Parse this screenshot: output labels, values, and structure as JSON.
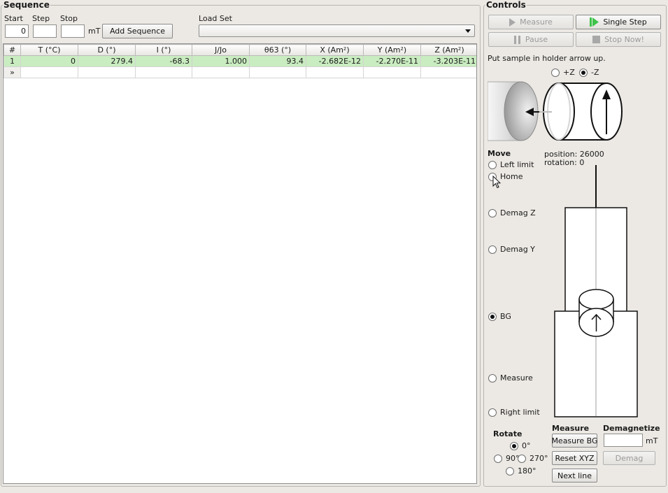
{
  "sequence": {
    "legend": "Sequence",
    "start_label": "Start",
    "step_label": "Step",
    "stop_label": "Stop",
    "start_value": "0",
    "step_value": "",
    "stop_value": "",
    "unit": "mT",
    "add_button": "Add Sequence",
    "load_set_label": "Load Set",
    "load_set_value": ""
  },
  "table": {
    "headers": [
      "#",
      "T (°C)",
      "D (°)",
      "I (°)",
      "J/Jo",
      "θ63 (°)",
      "X (Am²)",
      "Y (Am²)",
      "Z (Am²)"
    ],
    "rows": [
      [
        "1",
        "0",
        "279.4",
        "-68.3",
        "1.000",
        "93.4",
        "-2.682E-12",
        "-2.270E-11",
        "-3.203E-11"
      ]
    ],
    "new_row_marker": "»"
  },
  "controls": {
    "legend": "Controls",
    "measure_button": "Measure",
    "single_step_button": "Single Step",
    "pause_button": "Pause",
    "stop_now_button": "Stop Now!",
    "instruction": "Put sample in holder arrow up.",
    "orientation_options": [
      {
        "label": "+Z",
        "selected": false
      },
      {
        "label": "-Z",
        "selected": true
      }
    ],
    "move_label": "Move",
    "position_text": "position: 26000",
    "rotation_text": "rotation: 0",
    "move_options": [
      {
        "label": "Left limit",
        "selected": false
      },
      {
        "label": "Home",
        "selected": false
      },
      {
        "label": "Demag Z",
        "selected": false
      },
      {
        "label": "Demag Y",
        "selected": false
      },
      {
        "label": "BG",
        "selected": true
      },
      {
        "label": "Measure",
        "selected": false
      },
      {
        "label": "Right limit",
        "selected": false
      }
    ],
    "rotate_label": "Rotate",
    "rotate_options": [
      {
        "label": "0°",
        "selected": true
      },
      {
        "label": "90°",
        "selected": false
      },
      {
        "label": "270°",
        "selected": false
      },
      {
        "label": "180°",
        "selected": false
      }
    ],
    "measure_group_label": "Measure",
    "measure_bg_button": "Measure BG",
    "reset_xyz_button": "Reset XYZ",
    "next_line_button": "Next line",
    "demagnetize_label": "Demagnetize",
    "demag_value": "",
    "demag_unit": "mT",
    "demag_button": "Demag"
  },
  "colors": {
    "background": "#ece9e4",
    "selected_row": "#c9ecc0",
    "play_icon": "#3fc34a",
    "disabled_text": "#9a9a9a"
  },
  "icons": {
    "measure": "play-icon",
    "single_step": "step-icon",
    "pause": "pause-icon",
    "stop": "stop-icon",
    "dropdown": "chevron-down-icon",
    "cursor": "mouse-cursor-icon"
  }
}
